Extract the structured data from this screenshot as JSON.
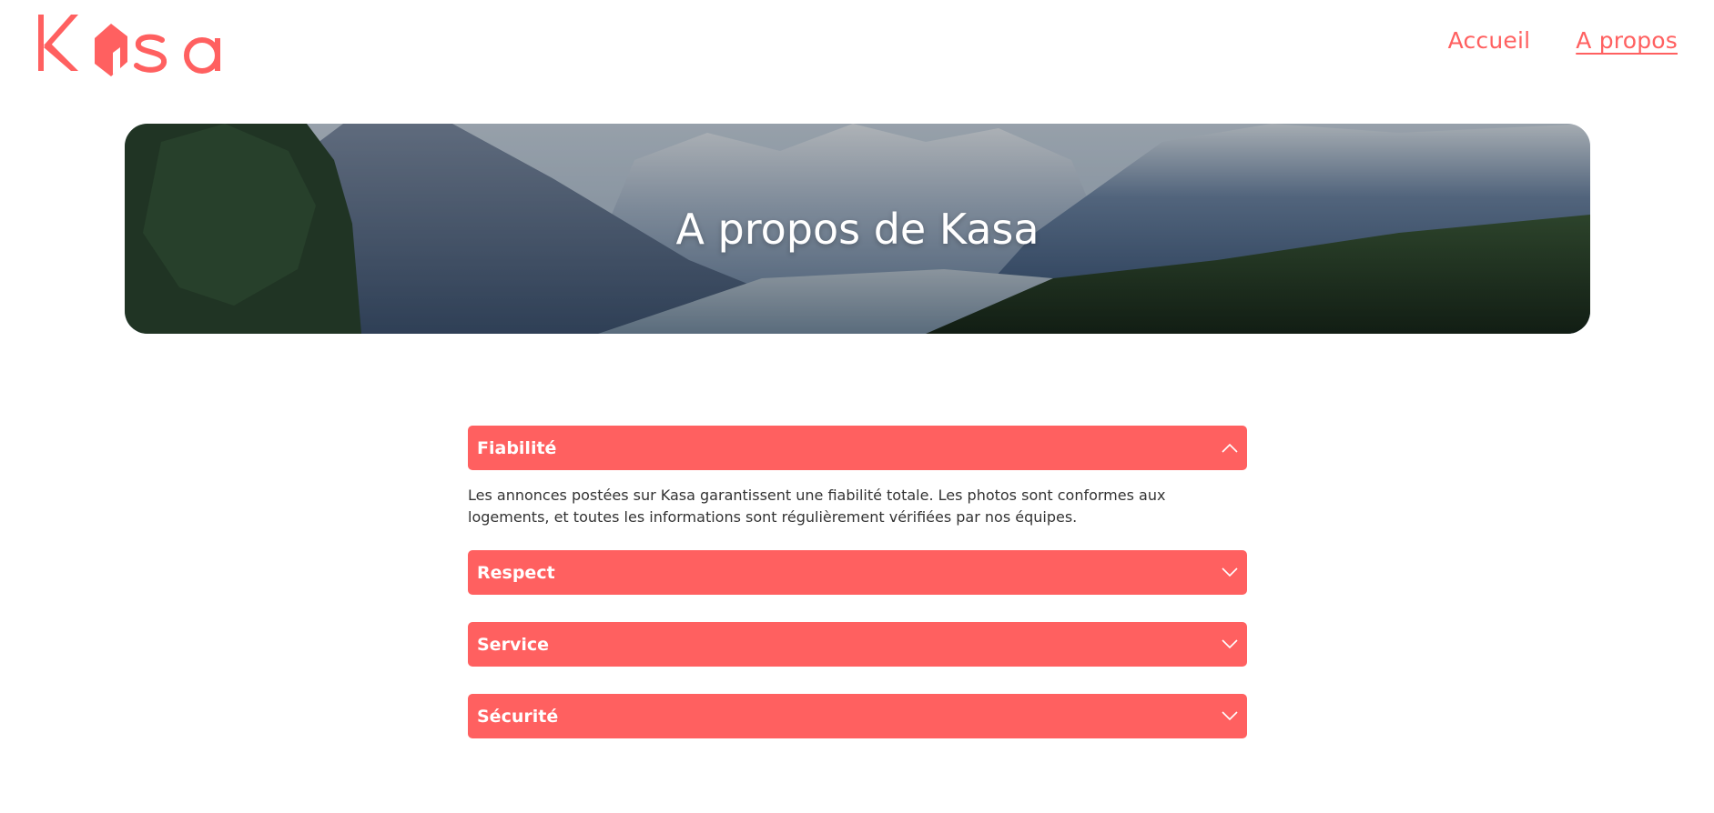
{
  "header": {
    "logo_text": "Kasa",
    "brand_color": "#FF6060",
    "nav": [
      {
        "label": "Accueil",
        "active": false
      },
      {
        "label": "A propos",
        "active": true
      }
    ]
  },
  "banner": {
    "title": "A propos de Kasa",
    "image": "mountain-valley-landscape"
  },
  "collapses": [
    {
      "title": "Fiabilité",
      "open": true,
      "icon": "chevron-up-icon",
      "content": "Les annonces postées sur Kasa garantissent une fiabilité totale. Les photos sont conformes aux logements, et toutes les informations sont régulièrement vérifiées par nos équipes."
    },
    {
      "title": "Respect",
      "open": false,
      "icon": "chevron-down-icon"
    },
    {
      "title": "Service",
      "open": false,
      "icon": "chevron-down-icon"
    },
    {
      "title": "Sécurité",
      "open": false,
      "icon": "chevron-down-icon"
    }
  ]
}
